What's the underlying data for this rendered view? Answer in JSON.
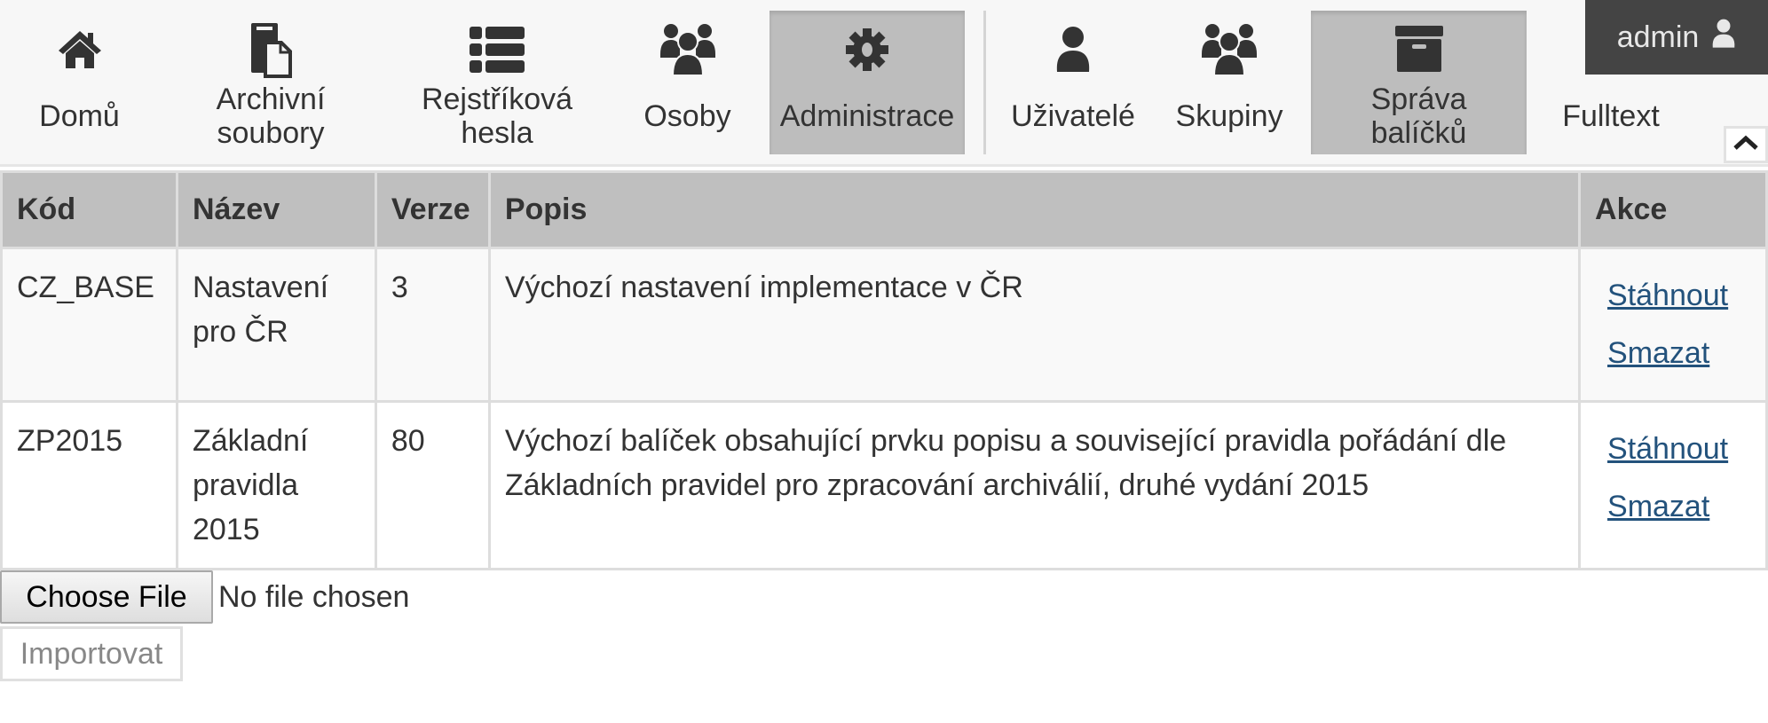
{
  "navbar": {
    "items": [
      {
        "label": "Domů",
        "icon": "home-icon"
      },
      {
        "label": "Archivní soubory",
        "icon": "file-copy-icon"
      },
      {
        "label": "Rejstříková hesla",
        "icon": "list-icon"
      },
      {
        "label": "Osoby",
        "icon": "users-icon"
      },
      {
        "label": "Administrace",
        "icon": "gear-icon",
        "active": true
      },
      {
        "label": "Uživatelé",
        "icon": "user-icon"
      },
      {
        "label": "Skupiny",
        "icon": "users-icon"
      },
      {
        "label": "Správa balíčků",
        "icon": "archive-box-icon",
        "active": true
      },
      {
        "label": "Fulltext",
        "icon": null
      }
    ],
    "user": {
      "name": "admin",
      "icon": "user-icon"
    },
    "collapse_icon": "chevron-up-icon"
  },
  "table": {
    "headers": [
      "Kód",
      "Název",
      "Verze",
      "Popis",
      "Akce"
    ],
    "rows": [
      {
        "code": "CZ_BASE",
        "name": "Nastavení pro ČR",
        "version": "3",
        "description": "Výchozí nastavení implementace v ČR",
        "actions": [
          "Stáhnout",
          "Smazat"
        ]
      },
      {
        "code": "ZP2015",
        "name": "Základní pravidla 2015",
        "version": "80",
        "description": "Výchozí balíček obsahující prvku popisu a související pravidla pořádání dle Základních pravidel pro zpracování archiválií, druhé vydání 2015",
        "actions": [
          "Stáhnout",
          "Smazat"
        ]
      }
    ]
  },
  "upload": {
    "choose_label": "Choose File",
    "status": "No file chosen",
    "import_label": "Importovat"
  },
  "colors": {
    "link": "#23527c",
    "active_nav": "#bdbdbd",
    "header_bg": "#bfbfbf",
    "user_bg": "#444444"
  }
}
